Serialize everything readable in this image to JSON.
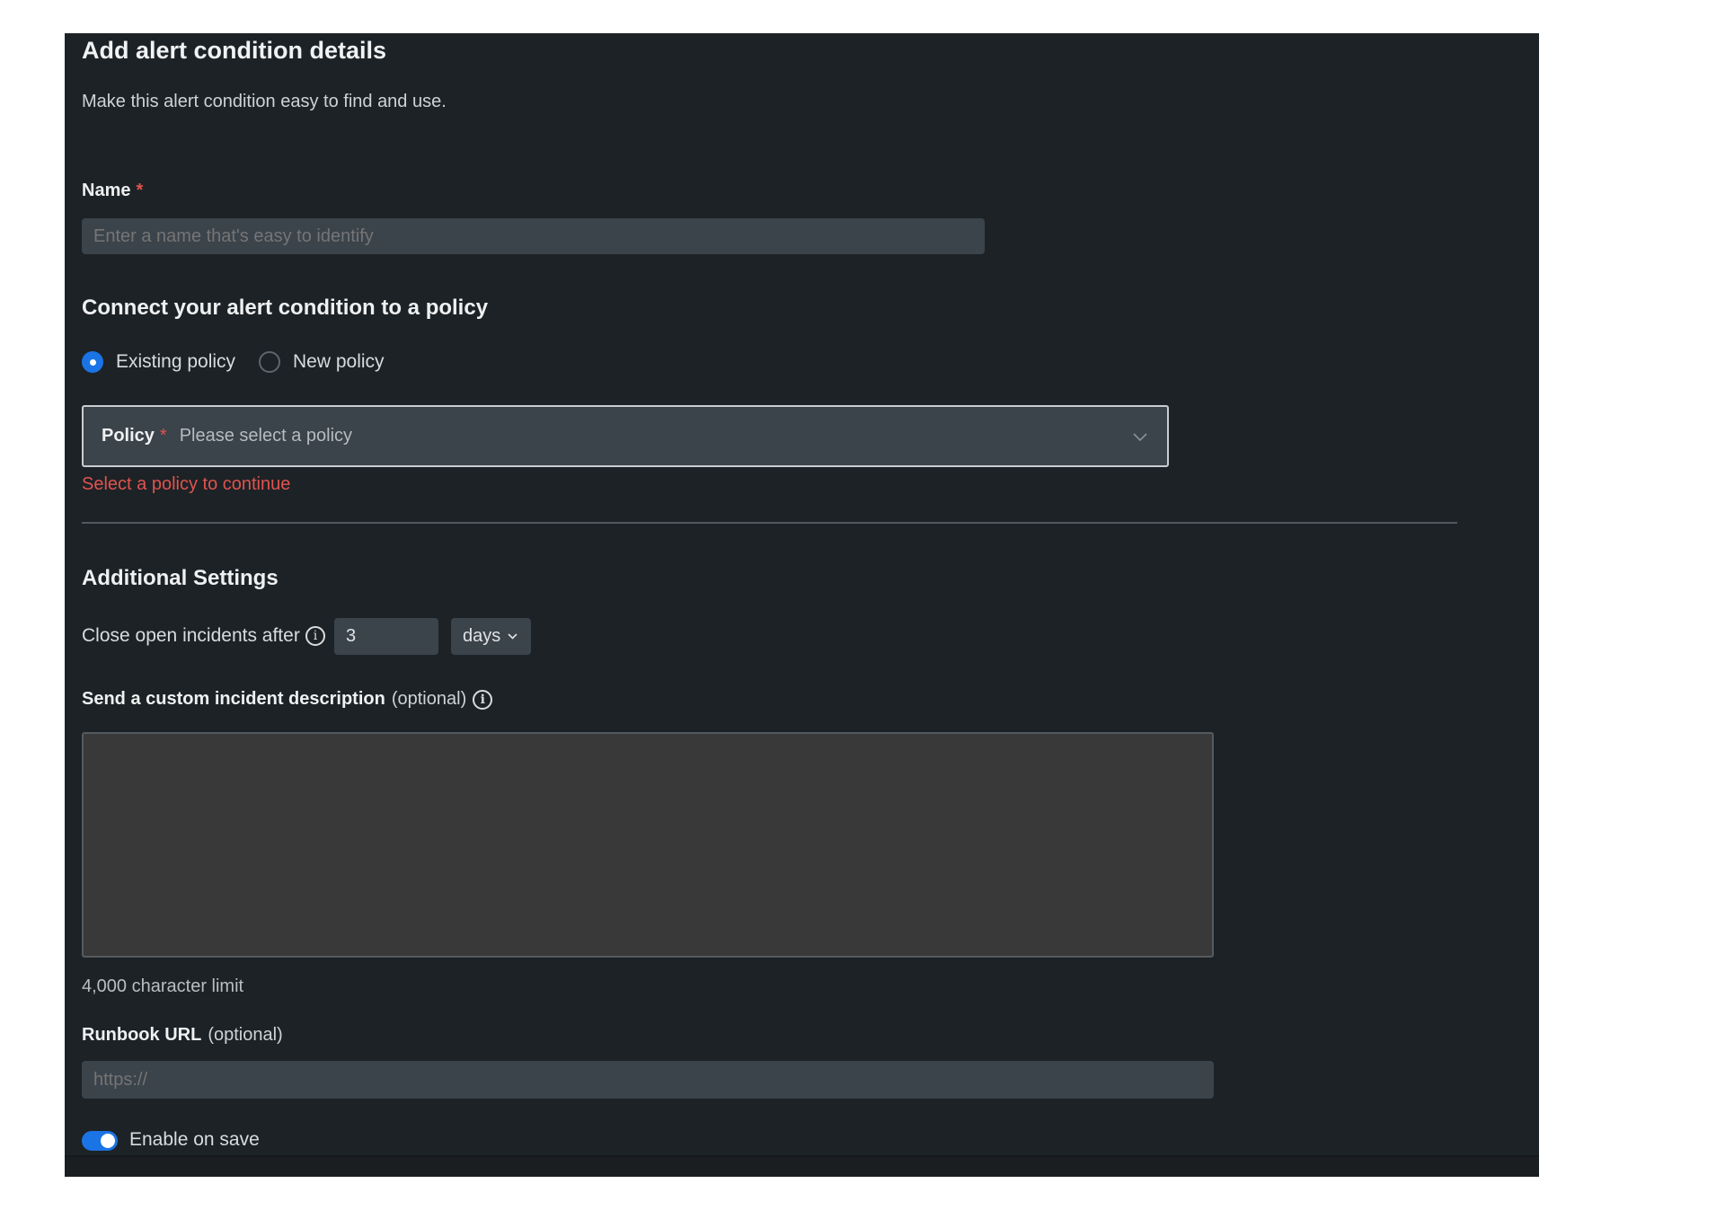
{
  "header": {
    "title": "Add alert condition details",
    "subtitle": "Make this alert condition easy to find and use."
  },
  "name_field": {
    "label": "Name",
    "required_mark": "*",
    "placeholder": "Enter a name that's easy to identify"
  },
  "policy_section": {
    "heading": "Connect your alert condition to a policy",
    "options": [
      {
        "label": "Existing policy",
        "selected": true
      },
      {
        "label": "New policy",
        "selected": false
      }
    ],
    "select": {
      "label": "Policy",
      "required_mark": "*",
      "placeholder": "Please select a policy"
    },
    "error": "Select a policy to continue"
  },
  "additional": {
    "heading": "Additional Settings",
    "close_label": "Close open incidents after",
    "close_value": "3",
    "close_unit": "days",
    "description_label": "Send a custom incident description",
    "optional": "(optional)",
    "char_limit": "4,000 character limit",
    "runbook_label": "Runbook URL",
    "runbook_placeholder": "https://",
    "enable_label": "Enable on save",
    "enable_on": true
  },
  "colors": {
    "panel": "#1d2226",
    "accent": "#1a74e6",
    "error": "#e0534e",
    "input": "#3b434b"
  }
}
